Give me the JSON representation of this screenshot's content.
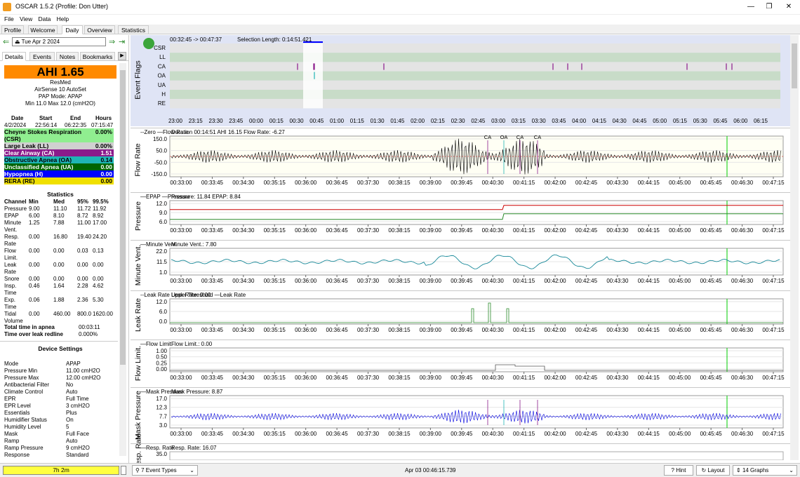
{
  "window": {
    "title": "OSCAR 1.5.2 (Profile: Don Utter)",
    "min": "—",
    "max": "❐",
    "close": "✕"
  },
  "menu": [
    "File",
    "View",
    "Data",
    "Help"
  ],
  "tabs": [
    "Profile",
    "Welcome",
    "Daily",
    "Overview",
    "Statistics"
  ],
  "date_nav": {
    "date": "Tue Apr 2 2024",
    "back": "⇐",
    "forward": "⇒",
    "end": "⇥"
  },
  "left_tabs": [
    "Details",
    "Events",
    "Notes",
    "Bookmarks"
  ],
  "ahi": {
    "label": "AHI 1.65",
    "bg": "#ff8a00"
  },
  "machine": {
    "brand": "ResMed",
    "model": "AirSense 10 AutoSet",
    "mode": "PAP Mode: APAP",
    "pressure": "Min 11.0 Max 12.0 (cmH2O)"
  },
  "session": {
    "headers": [
      "Date",
      "Start",
      "End",
      "Hours"
    ],
    "values": [
      "4/2/2024",
      "22:56:14",
      "06:22:35",
      "07:15:47"
    ]
  },
  "events": [
    {
      "name": "Cheyne Stokes Respiration (CSR)",
      "value": "0.00%",
      "color": "#90ee90",
      "text": "#000"
    },
    {
      "name": "Large Leak (LL)",
      "value": "0.00%",
      "color": "#d0d0d0",
      "text": "#000"
    },
    {
      "name": "Clear Airway (CA)",
      "value": "1.51",
      "color": "#8b1a8b",
      "text": "#fff"
    },
    {
      "name": "Obstructive Apnea (OA)",
      "value": "0.14",
      "color": "#1fb5b5",
      "text": "#000"
    },
    {
      "name": "Unclassified Apnea (UA)",
      "value": "0.00",
      "color": "#006400",
      "text": "#fff"
    },
    {
      "name": "Hypopnea (H)",
      "value": "0.00",
      "color": "#0000ff",
      "text": "#fff"
    },
    {
      "name": "RERA (RE)",
      "value": "0.00",
      "color": "#f0e000",
      "text": "#000"
    }
  ],
  "stats": {
    "title": "Statistics",
    "headers": [
      "Channel",
      "Min",
      "Med",
      "95%",
      "99.5%"
    ],
    "rows": [
      [
        "Pressure",
        "9.00",
        "11.10",
        "11.72",
        "11.92"
      ],
      [
        "EPAP",
        "6.00",
        "8.10",
        "8.72",
        "8.92"
      ],
      [
        "Minute Vent.",
        "1.25",
        "7.88",
        "11.00",
        "17.00"
      ],
      [
        "Resp. Rate",
        "0.00",
        "16.80",
        "19.40",
        "24.20"
      ],
      [
        "Flow Limit.",
        "0.00",
        "0.00",
        "0.03",
        "0.13"
      ],
      [
        "Leak Rate",
        "0.00",
        "0.00",
        "0.00",
        "0.00"
      ],
      [
        "Snore",
        "0.00",
        "0.00",
        "0.00",
        "0.00"
      ],
      [
        "Insp. Time",
        "0.46",
        "1.64",
        "2.28",
        "4.62"
      ],
      [
        "Exp. Time",
        "0.06",
        "1.88",
        "2.36",
        "5.30"
      ],
      [
        "Tidal Volume",
        "0.00",
        "460.00",
        "800.0",
        "1620.00"
      ]
    ],
    "apnea_label": "Total time in apnea",
    "apnea_value": "00:03:11",
    "leak_label": "Time over leak redline",
    "leak_value": "0.000%"
  },
  "device": {
    "title": "Device Settings",
    "rows": [
      [
        "Mode",
        "APAP"
      ],
      [
        "Pressure Min",
        "11.00 cmH2O"
      ],
      [
        "Pressure Max",
        "12.00 cmH2O"
      ],
      [
        "Antibacterial Filter",
        "No"
      ],
      [
        "Climate Control",
        "Auto"
      ],
      [
        "EPR",
        "Full Time"
      ],
      [
        "EPR Level",
        "3 cmH2O"
      ],
      [
        "Essentials",
        "Plus"
      ],
      [
        "Humidifier Status",
        "On"
      ],
      [
        "Humidity Level",
        "5"
      ],
      [
        "Mask",
        "Full Face"
      ],
      [
        "Ramp",
        "Auto"
      ],
      [
        "Ramp Pressure",
        "9 cmH2O"
      ],
      [
        "Response",
        "Standard"
      ]
    ]
  },
  "bottom_bar": {
    "duration": "7h 2m",
    "event_types": "7 Event Types",
    "timestamp": "Apr 03 00:46:15.739",
    "hint": "Hint",
    "layout": "Layout",
    "graphs": "14 Graphs"
  },
  "flags_graph": {
    "label": "Event Flags",
    "range": "00:32:45 -> 00:47:37",
    "selection": "Selection Length: 0:14:51.421",
    "rows": [
      "CSR",
      "LL",
      "CA",
      "OA",
      "UA",
      "H",
      "RE"
    ],
    "times": [
      "23:00",
      "23:15",
      "23:30",
      "23:45",
      "00:00",
      "00:15",
      "00:30",
      "00:45",
      "01:00",
      "01:15",
      "01:30",
      "01:45",
      "02:00",
      "02:15",
      "02:30",
      "02:45",
      "03:00",
      "03:15",
      "03:30",
      "03:45",
      "04:00",
      "04:15",
      "04:30",
      "04:45",
      "05:00",
      "05:15",
      "05:30",
      "05:45",
      "06:00",
      "06:15"
    ]
  },
  "xticks": [
    "00:33:00",
    "00:33:45",
    "00:34:30",
    "00:35:15",
    "00:36:00",
    "00:36:45",
    "00:37:30",
    "00:38:15",
    "00:39:00",
    "00:39:45",
    "00:40:30",
    "00:41:15",
    "00:42:00",
    "00:42:45",
    "00:43:30",
    "00:44:15",
    "00:45:00",
    "00:45:45",
    "00:46:30",
    "00:47:15"
  ],
  "graphs": [
    {
      "label": "Flow Rate",
      "title": "Duration 00:14:51 AHI 16.15 Flow Rate: -6.27",
      "legend": "--Zero —Flow Rate",
      "yticks": [
        "150.0",
        "50.0",
        "-50.0",
        "-150.0"
      ]
    },
    {
      "label": "Pressure",
      "title": "Pressure: 11.84 EPAP: 8.84",
      "legend": "—EPAP —Pressure",
      "yticks": [
        "12.0",
        "9.0",
        "6.0"
      ]
    },
    {
      "label": "Minute Vent.",
      "title": "Minute Vent.: 7.80",
      "legend": "—Minute Vent.",
      "yticks": [
        "22.0",
        "11.5",
        "1.0"
      ]
    },
    {
      "label": "Leak Rate",
      "title": "Leak Rate: 0.00",
      "legend": "--Leak Rate Upper Threshold —Leak Rate",
      "yticks": [
        "12.0",
        "6.0",
        "0.0"
      ]
    },
    {
      "label": "Flow Limit.",
      "title": "Flow Limit.: 0.00",
      "legend": "—Flow Limit.",
      "yticks": [
        "1.00",
        "0.50",
        "0.25",
        "0.00"
      ]
    },
    {
      "label": "Mask Pressure",
      "title": "Mask Pressure: 8.87",
      "legend": "—Mask Pressure",
      "yticks": [
        "17.0",
        "12.3",
        "7.7",
        "3.0"
      ]
    },
    {
      "label": "Resp. Rate",
      "title": "Resp. Rate: 16.07",
      "legend": "—Resp. Rate",
      "yticks": [
        "35.0"
      ]
    }
  ],
  "event_markers": [
    "CA",
    "OA",
    "CA",
    "CA"
  ]
}
